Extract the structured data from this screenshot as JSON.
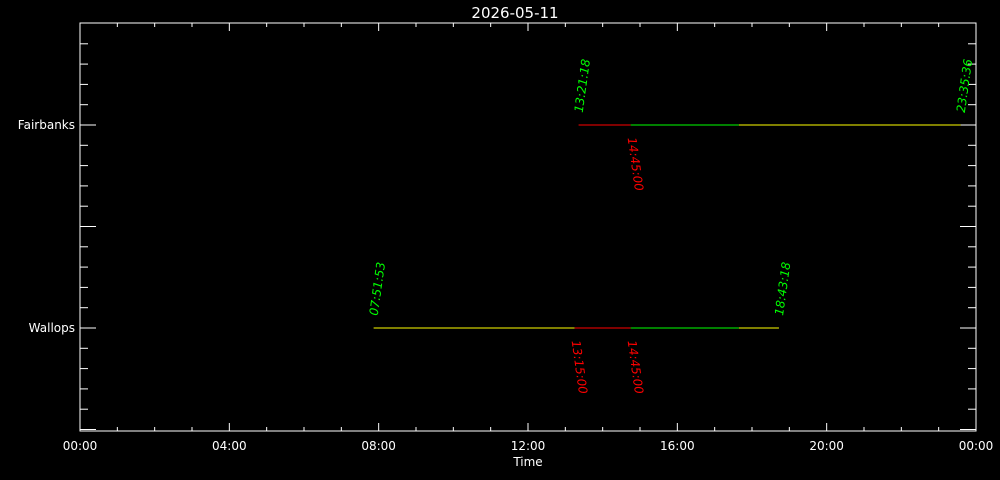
{
  "chart_data": {
    "type": "timeline",
    "title": "2026-05-11",
    "xlabel": "Time",
    "ylabel": "",
    "xlim_hours": [
      0,
      24
    ],
    "x_tick_labels": [
      "00:00",
      "04:00",
      "08:00",
      "12:00",
      "16:00",
      "20:00",
      "00:00"
    ],
    "x_major_step_hours": 4,
    "x_minor_step_hours": 1,
    "grid": false,
    "colors": {
      "background": "#000000",
      "axis": "#ffffff",
      "start_stop": "#00ff00",
      "marker": "#ff0000",
      "yellow": "#ffff00",
      "green": "#00ff00",
      "red": "#ff0000",
      "white": "#ffffff"
    },
    "stations": [
      {
        "name": "Fairbanks",
        "start_label": "13:21:18",
        "stop_label": "23:35:36",
        "markers": [
          "14:45:00"
        ],
        "segments": [
          {
            "from": 13.355,
            "to": 14.75,
            "color": "red"
          },
          {
            "from": 14.75,
            "to": 17.65,
            "color": "green"
          },
          {
            "from": 17.65,
            "to": 23.593,
            "color": "yellow"
          },
          {
            "from": 23.593,
            "to": 24.0,
            "color": "white"
          }
        ],
        "start_hours": 13.355,
        "stop_hours": 23.593,
        "marker_hours": [
          14.75
        ]
      },
      {
        "name": "Wallops",
        "start_label": "07:51:53",
        "stop_label": "18:43:18",
        "markers": [
          "13:15:00",
          "14:45:00"
        ],
        "segments": [
          {
            "from": 7.865,
            "to": 13.25,
            "color": "yellow"
          },
          {
            "from": 13.25,
            "to": 14.75,
            "color": "red"
          },
          {
            "from": 14.75,
            "to": 17.65,
            "color": "green"
          },
          {
            "from": 17.65,
            "to": 18.722,
            "color": "yellow"
          }
        ],
        "start_hours": 7.865,
        "stop_hours": 18.722,
        "marker_hours": [
          13.25,
          14.75
        ]
      }
    ]
  }
}
